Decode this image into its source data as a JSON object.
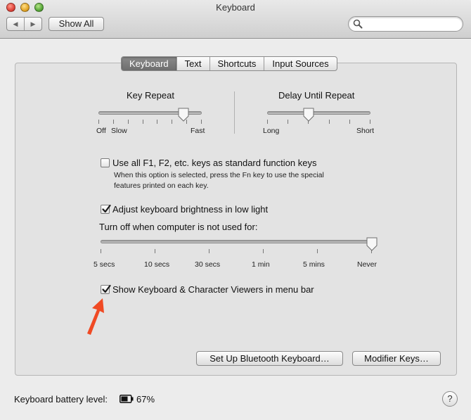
{
  "window": {
    "title": "Keyboard"
  },
  "toolbar": {
    "back_icon": "chevron-left-icon",
    "forward_icon": "chevron-right-icon",
    "show_all_label": "Show All",
    "search": {
      "value": "",
      "placeholder": ""
    }
  },
  "tabs": [
    {
      "label": "Keyboard",
      "selected": true
    },
    {
      "label": "Text",
      "selected": false
    },
    {
      "label": "Shortcuts",
      "selected": false
    },
    {
      "label": "Input Sources",
      "selected": false
    }
  ],
  "key_repeat": {
    "label": "Key Repeat",
    "min_label": "Off",
    "low_label": "Slow",
    "max_label": "Fast",
    "value_fraction": 0.82
  },
  "delay_until_repeat": {
    "label": "Delay Until Repeat",
    "min_label": "Long",
    "max_label": "Short",
    "value_fraction": 0.4
  },
  "function_keys": {
    "label": "Use all F1, F2, etc. keys as standard function keys",
    "checked": false,
    "description_line1": "When this option is selected, press the Fn key to use the special",
    "description_line2": "features printed on each key."
  },
  "brightness": {
    "label": "Adjust keyboard brightness in low light",
    "checked": true,
    "turn_off_label": "Turn off when computer is not used for:",
    "ticks": [
      "5 secs",
      "10 secs",
      "30 secs",
      "1 min",
      "5 mins",
      "Never"
    ],
    "value": "Never"
  },
  "viewers": {
    "label": "Show Keyboard & Character Viewers in menu bar",
    "checked": true
  },
  "buttons": {
    "bluetooth": "Set Up Bluetooth Keyboard…",
    "modifier": "Modifier Keys…"
  },
  "battery": {
    "label": "Keyboard battery level:",
    "icon": "battery-icon",
    "level": "67%"
  },
  "help_label": "?",
  "colors": {
    "annotation_arrow": "#f04a24",
    "selected_tab": "#7a7a7a"
  }
}
